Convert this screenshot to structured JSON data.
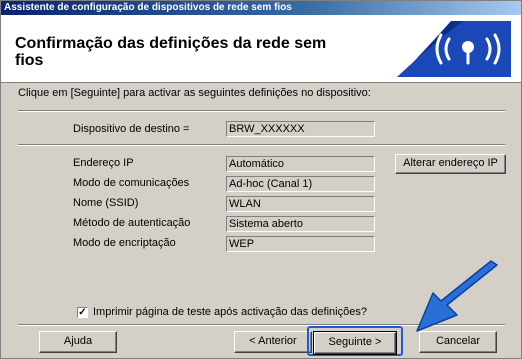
{
  "window": {
    "title": "Assistente de configuração de dispositivos de rede sem fios"
  },
  "header": {
    "title": "Confirmação das definições da rede sem fios"
  },
  "intro": "Clique em [Seguinte] para activar as seguintes definições no dispositivo:",
  "destination": {
    "label": "Dispositivo de destino =",
    "value": "BRW_XXXXXX"
  },
  "settings": [
    {
      "label": "Endereço IP",
      "value": "Automático"
    },
    {
      "label": "Modo de comunicações",
      "value": "Ad-hoc (Canal 1)"
    },
    {
      "label": "Nome (SSID)",
      "value": "WLAN"
    },
    {
      "label": "Método de autenticação",
      "value": "Sistema aberto"
    },
    {
      "label": "Modo de encriptação",
      "value": "WEP"
    }
  ],
  "change_ip_button": "Alterar endereço IP",
  "print_test": {
    "checked": true,
    "check_mark": "✓",
    "label": "Imprimir página de teste após activação das definições?"
  },
  "buttons": {
    "help": "Ajuda",
    "back": "< Anterior",
    "next": "Seguinte >",
    "cancel": "Cancelar"
  },
  "colors": {
    "title_bar": "#0a246a",
    "dialog_face": "#d4d0c8",
    "highlight": "#1e5bd8",
    "arrow": "#2a6fd6"
  },
  "icons": {
    "logo": "wireless-signal-icon",
    "pointer": "pointer-arrow-icon"
  }
}
